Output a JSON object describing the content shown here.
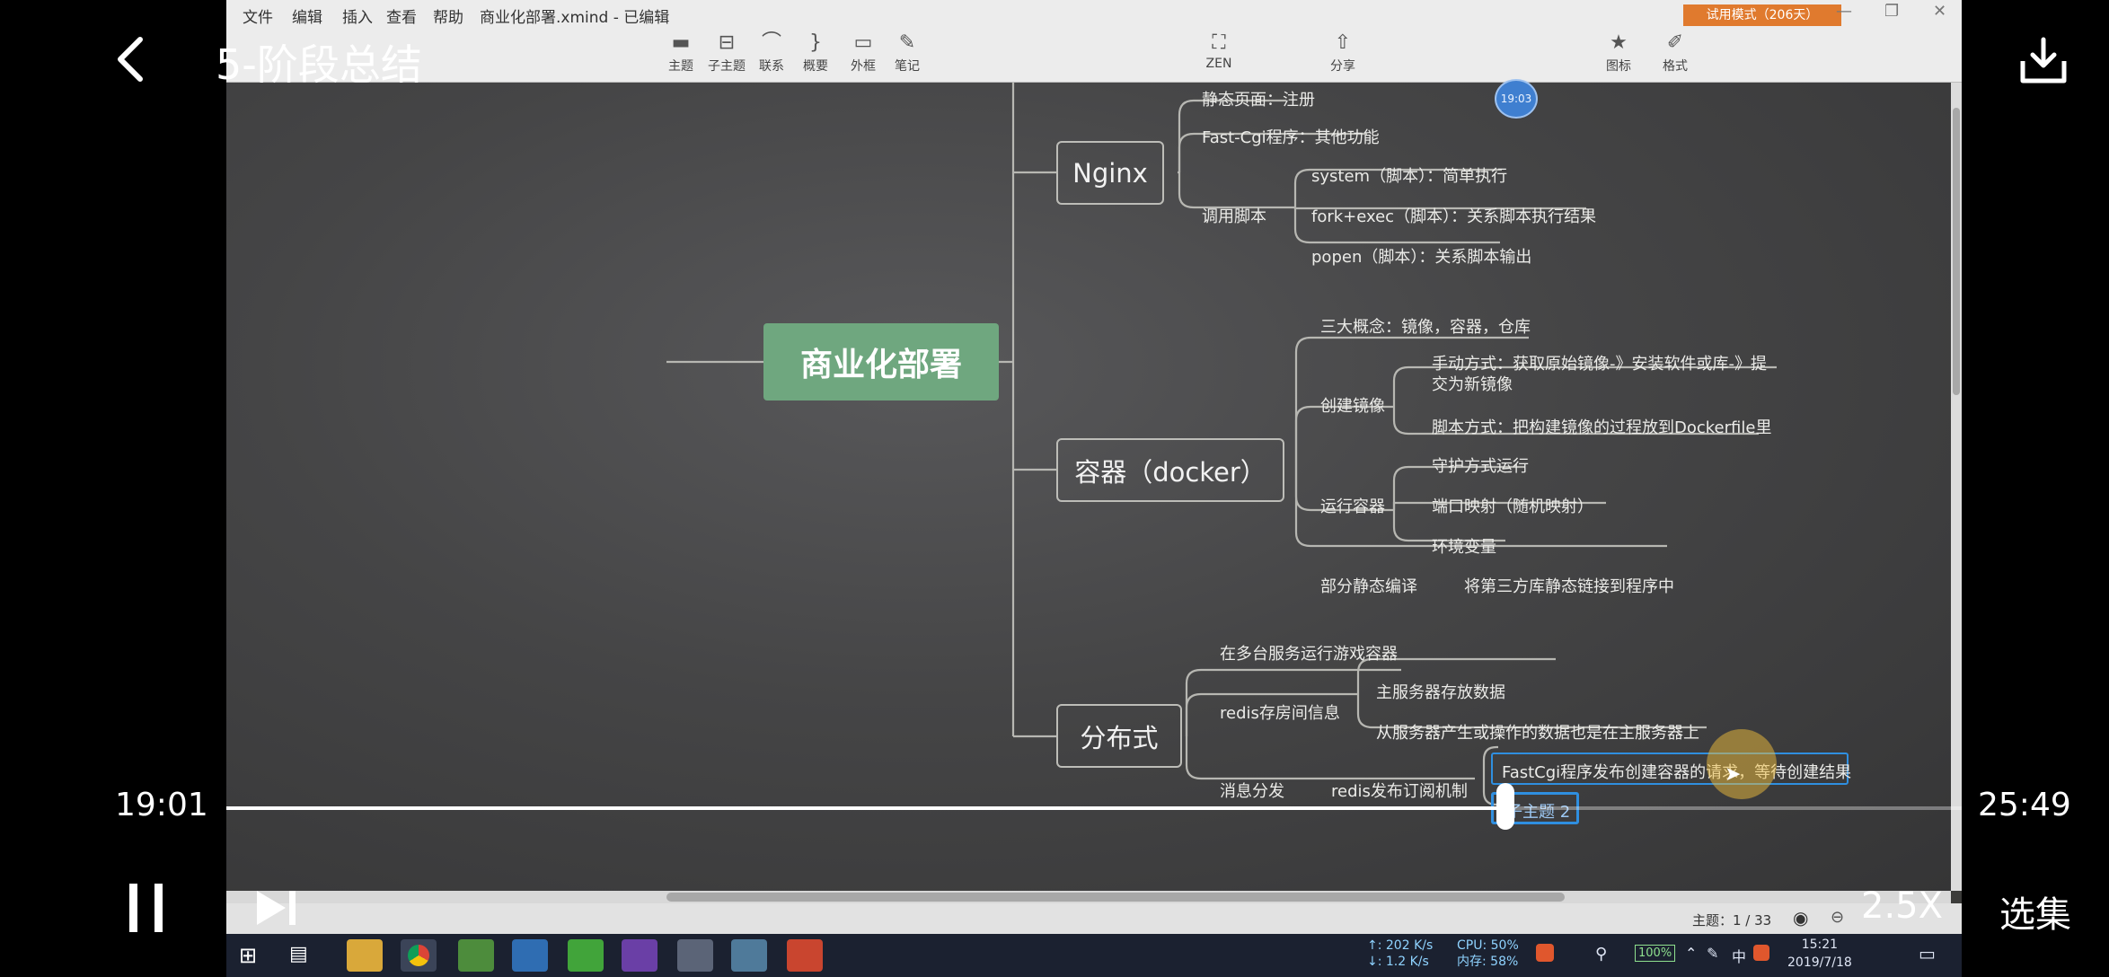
{
  "player": {
    "title": "5-阶段总结",
    "current_time": "19:01",
    "total_time": "25:49",
    "speed": "2.5X",
    "episodes_label": "选集",
    "progress_fraction": 0.737
  },
  "app": {
    "menu": [
      "文件",
      "编辑",
      "插入",
      "查看",
      "帮助"
    ],
    "file_title": "商业化部署.xmind - 已编辑",
    "toolbar": [
      {
        "label": "主题",
        "icon": "topic-icon"
      },
      {
        "label": "子主题",
        "icon": "subtopic-icon"
      },
      {
        "label": "联系",
        "icon": "relationship-icon"
      },
      {
        "label": "概要",
        "icon": "summary-icon"
      },
      {
        "label": "外框",
        "icon": "boundary-icon"
      },
      {
        "label": "笔记",
        "icon": "note-icon"
      },
      {
        "label": "ZEN",
        "icon": "zen-icon"
      },
      {
        "label": "分享",
        "icon": "share-icon"
      },
      {
        "label": "图标",
        "icon": "star-icon"
      },
      {
        "label": "格式",
        "icon": "format-icon"
      }
    ],
    "trial_badge": "试用模式（206天）",
    "status": "主题：1 / 33",
    "time_bubble": "19:03"
  },
  "mindmap": {
    "root": "商业化部署",
    "nginx": {
      "title": "Nginx",
      "static": "静态页面：注册",
      "fastcgi": "Fast-Cgi程序：其他功能",
      "script": "调用脚本",
      "system": "system（脚本）：简单执行",
      "fork": "fork+exec（脚本）：关系脚本执行结果",
      "popen": "popen（脚本）：关系脚本输出"
    },
    "docker": {
      "title": "容器（docker）",
      "concepts": "三大概念：镜像，容器，仓库",
      "create": "创建镜像",
      "manual": "手动方式：获取原始镜像-》安装软件或库-》提交为新镜像",
      "script": "脚本方式：把构建镜像的过程放到Dockerfile里",
      "run": "运行容器",
      "daemon": "守护方式运行",
      "port": "端口映射（随机映射）",
      "env": "环境变量",
      "static_compile": "部分静态编译",
      "static_detail": "将第三方库静态链接到程序中"
    },
    "distributed": {
      "title": "分布式",
      "multi": "在多台服务运行游戏容器",
      "redis_store": "redis存房间信息",
      "master": "主服务器存放数据",
      "slave": "从服务器产生或操作的数据也是在主服务器上",
      "message": "消息分发",
      "pubsub": "redis发布订阅机制",
      "fastcgi_publish": "FastCgi程序发布创建容器的请求，等待创建结果",
      "subtopic2": "子主题 2"
    }
  },
  "taskbar": {
    "net_up": "↑: 202 K/s",
    "net_down": "↓: 1.2 K/s",
    "cpu": "CPU: 50%",
    "mem": "内存: 58%",
    "battery": "100%",
    "ime": "中",
    "clock_time": "15:21",
    "clock_date": "2019/7/18"
  }
}
